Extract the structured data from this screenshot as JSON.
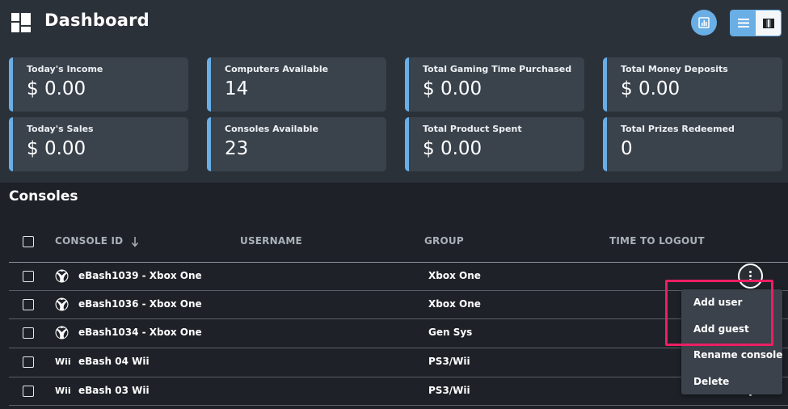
{
  "header": {
    "title": "Dashboard",
    "logo_icon": "dashboard-grid-icon",
    "chart_icon": "bar-chart-icon",
    "view_toggle": {
      "list_icon": "list-icon",
      "grid_icon": "columns-icon",
      "active": "list"
    },
    "accent_color": "#6aaee6"
  },
  "stats": [
    {
      "label": "Today's Income",
      "value": "$ 0.00"
    },
    {
      "label": "Computers Available",
      "value": "14"
    },
    {
      "label": "Total Gaming Time Purchased",
      "value": "$ 0.00"
    },
    {
      "label": "Total Money Deposits",
      "value": "$ 0.00"
    },
    {
      "label": "Today's Sales",
      "value": "$ 0.00"
    },
    {
      "label": "Consoles Available",
      "value": "23"
    },
    {
      "label": "Total Product Spent",
      "value": "$ 0.00"
    },
    {
      "label": "Total Prizes Redeemed",
      "value": "0"
    }
  ],
  "consoles": {
    "title": "Consoles",
    "columns": [
      "CONSOLE ID",
      "USERNAME",
      "GROUP",
      "TIME TO LOGOUT"
    ],
    "sort_icon": "arrow-down-icon",
    "rows": [
      {
        "icon": "xbox-icon",
        "id": "eBash1039 - Xbox One",
        "username": "",
        "group": "Xbox One",
        "time_to_logout": ""
      },
      {
        "icon": "xbox-icon",
        "id": "eBash1036 - Xbox One",
        "username": "",
        "group": "Xbox One",
        "time_to_logout": ""
      },
      {
        "icon": "xbox-icon",
        "id": "eBash1034 - Xbox One",
        "username": "",
        "group": "Gen Sys",
        "time_to_logout": ""
      },
      {
        "icon": "wii-icon",
        "icon_text": "Wii",
        "id": "eBash 04 Wii",
        "username": "",
        "group": "PS3/Wii",
        "time_to_logout": ""
      },
      {
        "icon": "wii-icon",
        "icon_text": "Wii",
        "id": "eBash 03 Wii",
        "username": "",
        "group": "PS3/Wii",
        "time_to_logout": ""
      }
    ]
  },
  "context_menu": {
    "trigger_icon": "more-vertical-icon",
    "items": [
      "Add user",
      "Add guest",
      "Rename console",
      "Delete"
    ],
    "highlight_color": "#ec1f63"
  }
}
